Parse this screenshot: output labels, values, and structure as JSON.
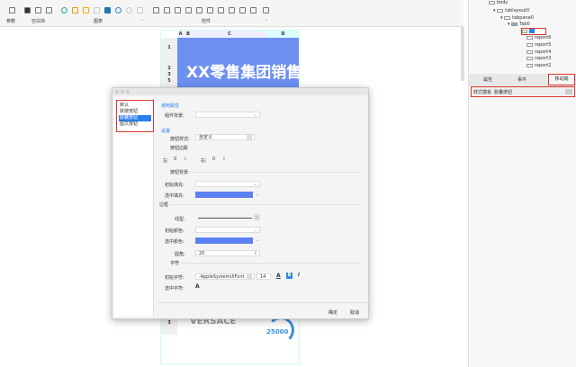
{
  "toolbar": {
    "param_label": "参数",
    "blank_label": "空白块",
    "chart_label": "图表",
    "widget_label": "控件"
  },
  "sheet": {
    "columns": [
      "A",
      "B",
      "C",
      "D"
    ],
    "rows": [
      "1",
      "2",
      "3",
      "5"
    ],
    "banner_title": "XX零售集团销售",
    "bottom_row": "3",
    "bottom_text": "VERSACE",
    "gauge_text": "25000"
  },
  "tree": {
    "items": [
      "body",
      "tablayout0",
      "tabpane0",
      "Tab0",
      "",
      "report6",
      "report5",
      "report4",
      "report3",
      "report2"
    ]
  },
  "right_tabs": [
    "属性",
    "事件",
    "移动端"
  ],
  "style_row": {
    "label": "样式模板",
    "value": "胶囊按钮"
  },
  "dialog": {
    "styles": [
      "默认",
      "默按按钮",
      "胶囊按钮",
      "图文按钮"
    ],
    "selected_style": "胶囊按钮",
    "general_section": "通用属性",
    "widget_bg_label": "组件背景:",
    "settings_section": "设置",
    "btn_style_label": "按钮样式:",
    "btn_style_value": "自定义",
    "btn_padding_label": "按钮边距",
    "left_label": "左:",
    "left_value": "0",
    "right_label": "右:",
    "right_value": "0",
    "btn_bg_label": "按钮背景:",
    "init_fill_label": "初始填充:",
    "sel_fill_label": "选中填充:",
    "border_section": "边框",
    "line_label": "线型:",
    "init_color_label": "初始颜色:",
    "sel_color_label": "选中颜色:",
    "radius_label": "圆角:",
    "radius_value": "20",
    "font_section": "字符",
    "init_font_label": "初始字符:",
    "font_value": ".AppleSystemUIFont",
    "font_size": "14",
    "bold_glyph": "B",
    "italic_glyph": "I",
    "color_glyph": "A",
    "sel_font_label": "选中字符:",
    "ok": "确定",
    "cancel": "取消",
    "accent": "#5b80f0"
  }
}
